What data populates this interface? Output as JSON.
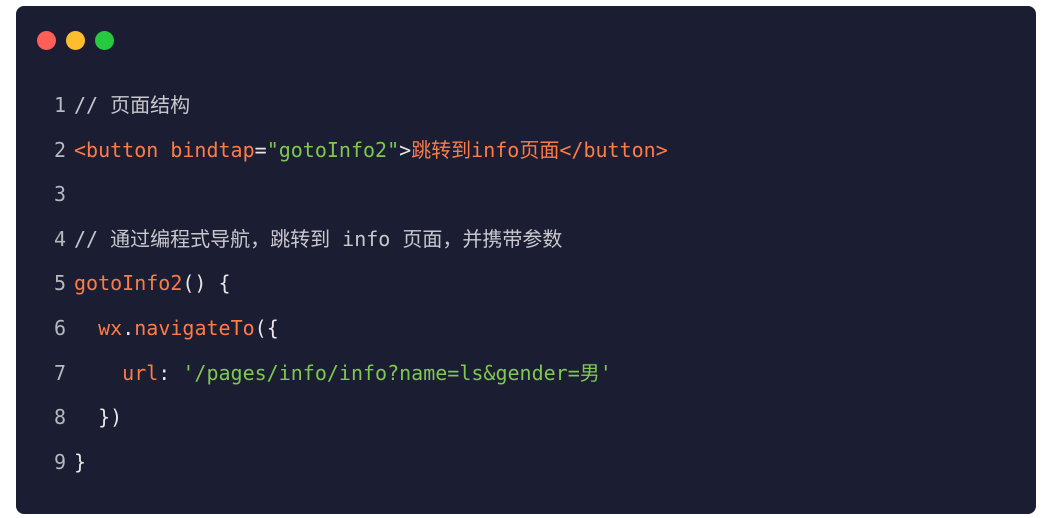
{
  "window": {
    "dots": [
      {
        "name": "close-dot",
        "color": "#ff5f56"
      },
      {
        "name": "minimize-dot",
        "color": "#ffbd2e"
      },
      {
        "name": "maximize-dot",
        "color": "#27c93f"
      }
    ]
  },
  "colors": {
    "background": "#1b1d33",
    "comment": "#c8c8cc",
    "tag": "#ff7b45",
    "attr": "#ff7b45",
    "string": "#7ec850",
    "plain": "#e6e6e6",
    "func": "#ff7b45",
    "key": "#ff7b45",
    "line_number": "#b8b8c0"
  },
  "code": {
    "lines": [
      {
        "num": "1",
        "tokens": [
          {
            "t": "// 页面结构",
            "c": "comment"
          }
        ]
      },
      {
        "num": "2",
        "tokens": [
          {
            "t": "<button",
            "c": "tag"
          },
          {
            "t": " ",
            "c": "plain"
          },
          {
            "t": "bindtap",
            "c": "attr"
          },
          {
            "t": "=",
            "c": "plain"
          },
          {
            "t": "\"gotoInfo2\"",
            "c": "string"
          },
          {
            "t": ">",
            "c": "plain"
          },
          {
            "t": "跳转到info页面",
            "c": "tag"
          },
          {
            "t": "</button>",
            "c": "tag"
          }
        ]
      },
      {
        "num": "3",
        "tokens": []
      },
      {
        "num": "4",
        "tokens": [
          {
            "t": "// 通过编程式导航，跳转到 info 页面，并携带参数",
            "c": "comment"
          }
        ]
      },
      {
        "num": "5",
        "tokens": [
          {
            "t": "gotoInfo2",
            "c": "func"
          },
          {
            "t": "() {",
            "c": "plain"
          }
        ]
      },
      {
        "num": "6",
        "tokens": [
          {
            "t": "  ",
            "c": "plain"
          },
          {
            "t": "wx",
            "c": "func"
          },
          {
            "t": ".",
            "c": "plain"
          },
          {
            "t": "navigateTo",
            "c": "func"
          },
          {
            "t": "({",
            "c": "plain"
          }
        ]
      },
      {
        "num": "7",
        "tokens": [
          {
            "t": "    ",
            "c": "plain"
          },
          {
            "t": "url",
            "c": "key"
          },
          {
            "t": ": ",
            "c": "plain"
          },
          {
            "t": "'/pages/info/info?name=ls&gender=男'",
            "c": "string"
          }
        ]
      },
      {
        "num": "8",
        "tokens": [
          {
            "t": "  })",
            "c": "plain"
          }
        ]
      },
      {
        "num": "9",
        "tokens": [
          {
            "t": "}",
            "c": "plain"
          }
        ]
      }
    ]
  }
}
